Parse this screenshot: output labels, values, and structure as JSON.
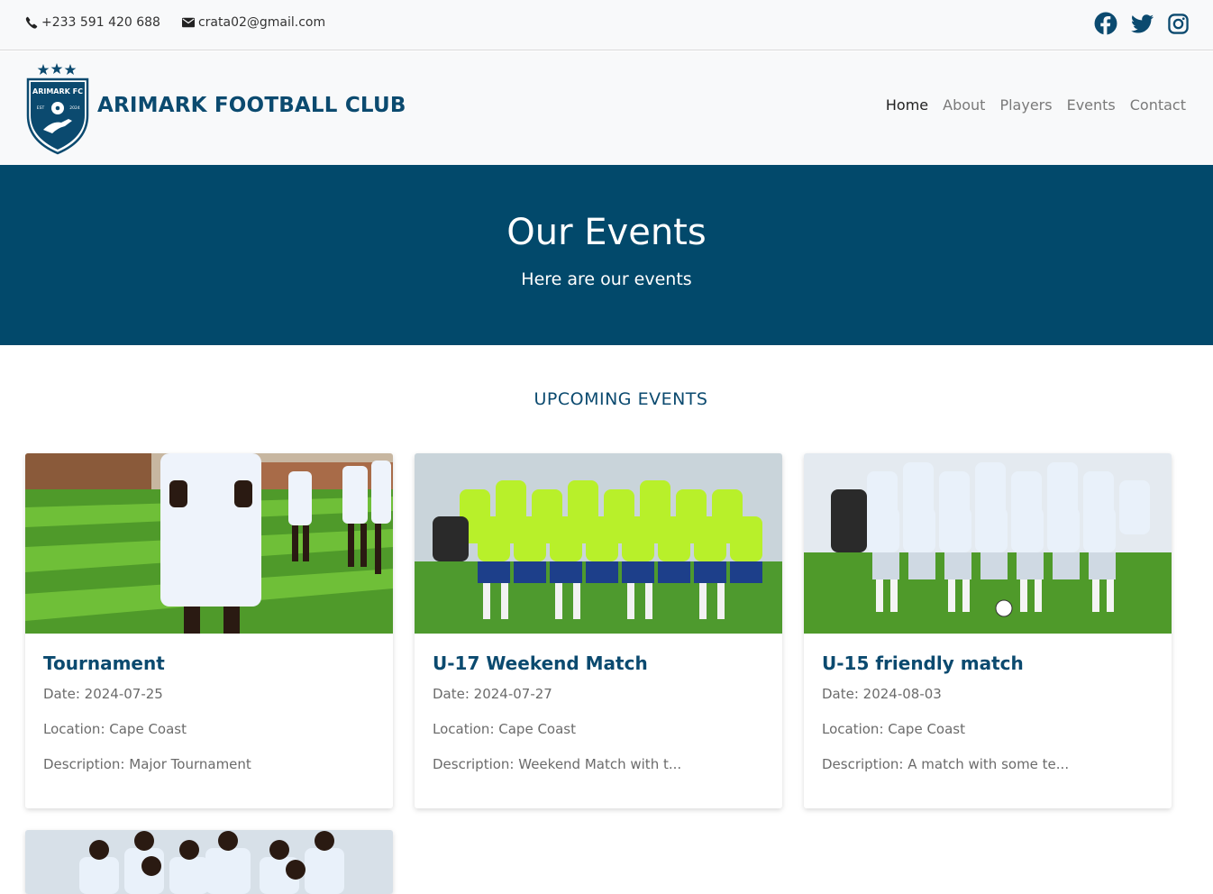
{
  "topbar": {
    "phone": "+233 591 420 688",
    "email": "crata02@gmail.com",
    "social_icons": [
      "facebook-icon",
      "twitter-icon",
      "instagram-icon"
    ]
  },
  "header": {
    "logo_text": "ARIMARK FC",
    "logo_est": "EST",
    "logo_year": "2024",
    "brand": "ARIMARK FOOTBALL CLUB",
    "nav": [
      "Home",
      "About",
      "Players",
      "Events",
      "Contact"
    ],
    "active_nav": "Home"
  },
  "hero": {
    "title": "Our Events",
    "subtitle": "Here are our events"
  },
  "section": {
    "title": "UPCOMING EVENTS"
  },
  "events": [
    {
      "title": "Tournament",
      "date": "Date: 2024-07-25",
      "location": "Location: Cape Coast",
      "description": "Description: Major Tournament"
    },
    {
      "title": "U-17 Weekend Match",
      "date": "Date: 2024-07-27",
      "location": "Location: Cape Coast",
      "description": "Description: Weekend Match with t..."
    },
    {
      "title": "U-15 friendly match",
      "date": "Date: 2024-08-03",
      "location": "Location: Cape Coast",
      "description": "Description: A match with some te..."
    }
  ],
  "colors": {
    "primary": "#02496b",
    "brand_text": "#0b4a6f",
    "topbar_bg": "#f8f9fa",
    "jersey_green": "#b8f02a",
    "jersey_white": "#e9f1fa"
  }
}
